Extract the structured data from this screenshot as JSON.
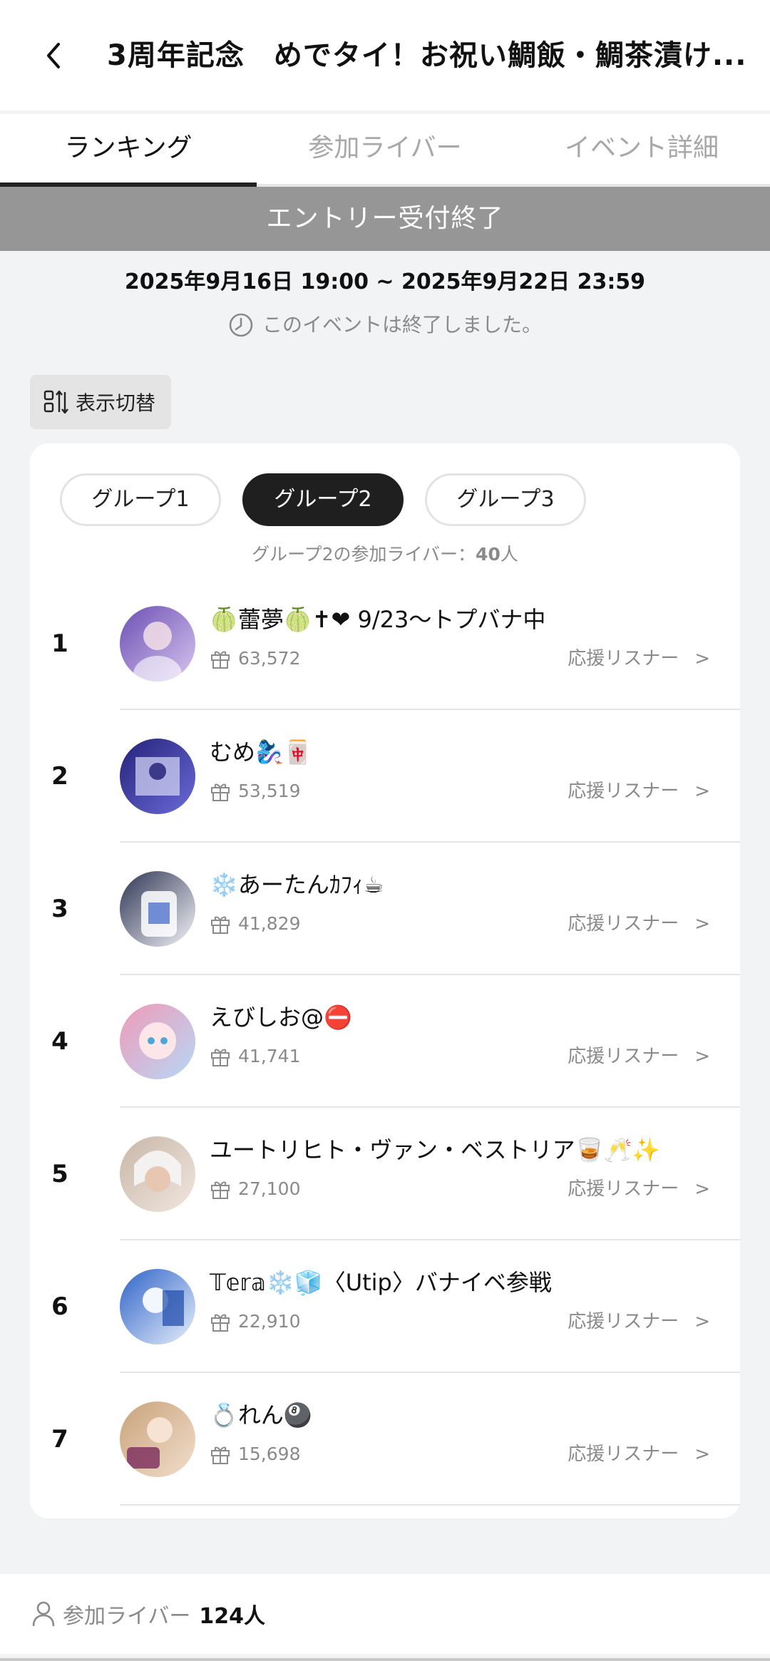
{
  "header": {
    "back_icon": "chevron-left-icon",
    "title": "3周年記念　めでタイ！お祝い鯛飯・鯛茶漬け..."
  },
  "tabs": [
    {
      "label": "ランキング",
      "active": true
    },
    {
      "label": "参加ライバー",
      "active": false
    },
    {
      "label": "イベント詳細",
      "active": false
    }
  ],
  "entry_banner": "エントリー受付終了",
  "event": {
    "period": "2025年9月16日 19:00 ~ 2025年9月22日 23:59",
    "status_icon": "clock-icon",
    "status": "このイベントは終了しました。"
  },
  "view_toggle": {
    "icon": "sort-toggle-icon",
    "label": "表示切替"
  },
  "groups": {
    "pills": [
      {
        "label": "グループ1",
        "active": false
      },
      {
        "label": "グループ2",
        "active": true
      },
      {
        "label": "グループ3",
        "active": false
      }
    ],
    "count_prefix": "グループ2の参加ライバー：",
    "count": "40",
    "count_suffix": "人"
  },
  "ranking": [
    {
      "rank": "1",
      "name": "🍈蕾夢🍈✝❤ 9/23〜トプバナ中",
      "points": "63,572",
      "link": "応援リスナー",
      "avatar": [
        "#6b4fb3",
        "#d8c6ef"
      ]
    },
    {
      "rank": "2",
      "name": "むめ🧞‍♀️🀄",
      "points": "53,519",
      "link": "応援リスナー",
      "avatar": [
        "#24227a",
        "#6b6bd8"
      ]
    },
    {
      "rank": "3",
      "name": "❄️あーたんｶﾌｨ☕",
      "points": "41,829",
      "link": "応援リスナー",
      "avatar": [
        "#2d3553",
        "#f4f4f8"
      ]
    },
    {
      "rank": "4",
      "name": "えびしお@⛔",
      "points": "41,741",
      "link": "応援リスナー",
      "avatar": [
        "#f09ab8",
        "#b6d8f6"
      ]
    },
    {
      "rank": "5",
      "name": "ユートリヒト・ヴァン・ベストリア🥃🥂✨",
      "points": "27,100",
      "link": "応援リスナー",
      "avatar": [
        "#c9b7a8",
        "#f0e6df"
      ]
    },
    {
      "rank": "6",
      "name": "𝕋𝕖𝕣𝕒❄️🧊〈Utip〉バナイベ参戦",
      "points": "22,910",
      "link": "応援リスナー",
      "avatar": [
        "#2f63c8",
        "#e8f0fb"
      ]
    },
    {
      "rank": "7",
      "name": "💍れん🎱",
      "points": "15,698",
      "link": "応援リスナー",
      "avatar": [
        "#c9a27a",
        "#f1dfcd"
      ]
    }
  ],
  "footer": {
    "icon": "person-icon",
    "label": "参加ライバー",
    "count": "124人"
  },
  "colors": {
    "banner": "#969696",
    "active_pill": "#1f1f1f",
    "muted_text": "#8a8a8a"
  }
}
